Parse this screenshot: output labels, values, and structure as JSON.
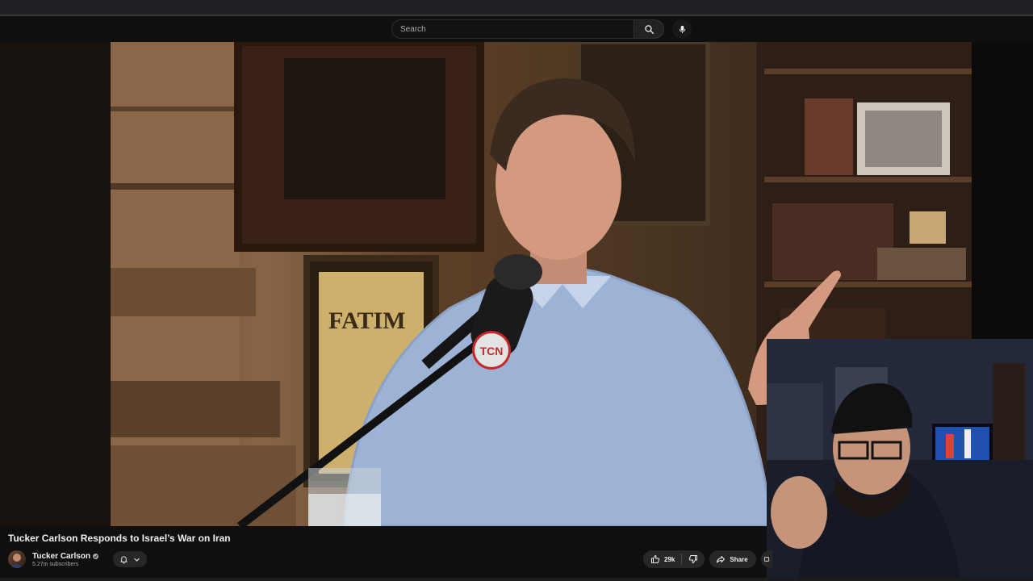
{
  "search": {
    "placeholder": "Search"
  },
  "video": {
    "title": "Tucker Carlson Responds to Israel’s War on Iran",
    "mic_logo_text": "TCN",
    "poster_text": "FATIM"
  },
  "channel": {
    "name": "Tucker Carlson",
    "subscribers": "5.27m subscribers"
  },
  "actions": {
    "likes": "29k",
    "share_label": "Share"
  },
  "colors": {
    "page_bg": "#0f0f0f",
    "chip_bg": "#272727",
    "text_primary": "#f1f1f1",
    "text_secondary": "#aaaaaa"
  },
  "icons": [
    "search-icon",
    "mic-icon",
    "verified-icon",
    "bell-icon",
    "chevron-down-icon",
    "thumbs-up-icon",
    "thumbs-down-icon",
    "share-icon",
    "more-icon"
  ]
}
